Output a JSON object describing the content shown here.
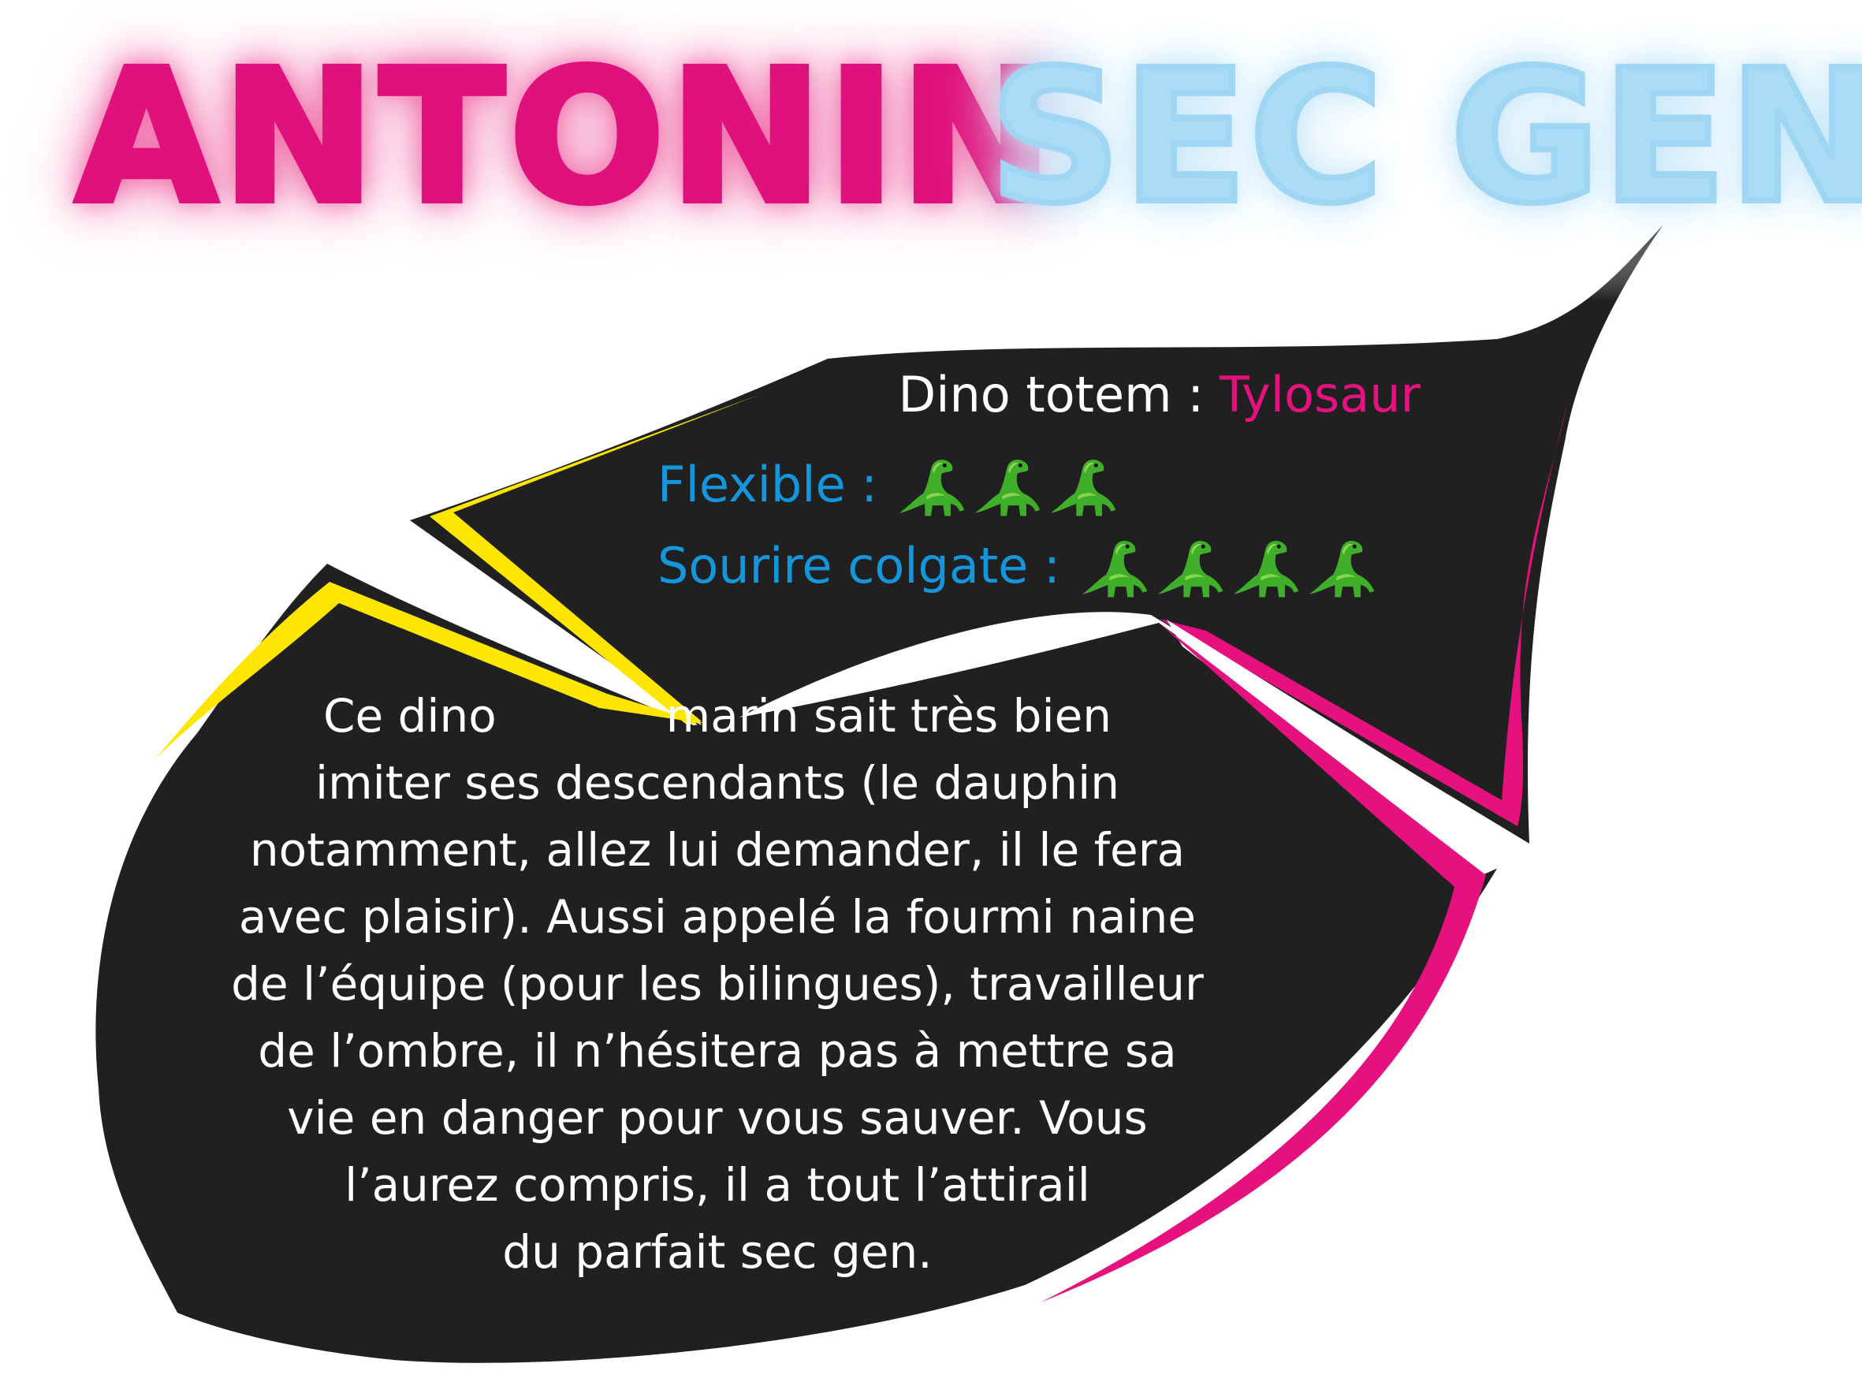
{
  "title": {
    "name": "ANTONIN",
    "role": "SEC GEN"
  },
  "colors": {
    "name_pink": "#e0107c",
    "role_blue": "#abdcf6",
    "bubble_black": "#202020",
    "accent_yellow": "#ffe600",
    "accent_pink": "#e6117f",
    "stat_blue": "#1496dc"
  },
  "profile": {
    "totem_label": "Dino totem : ",
    "totem_value": "Tylosaur",
    "flexible_label": "Flexible :",
    "flexible_rating": 3,
    "sourire_label": "Sourire colgate :",
    "sourire_rating": 4,
    "rating_icon": "green-dinosaur-icon"
  },
  "description": {
    "line1_a": "Ce dino",
    "line1_b": "marin sait très bien",
    "lines": [
      "imiter ses descendants (le dauphin",
      "notamment, allez lui demander, il le fera",
      "avec plaisir). Aussi appelé la fourmi naine",
      "de l’équipe (pour les bilingues), travailleur",
      "de l’ombre, il n’hésitera pas à mettre sa",
      "vie en danger pour vous sauver. Vous",
      "l’aurez compris, il a tout l’attirail",
      "du parfait sec gen."
    ]
  }
}
